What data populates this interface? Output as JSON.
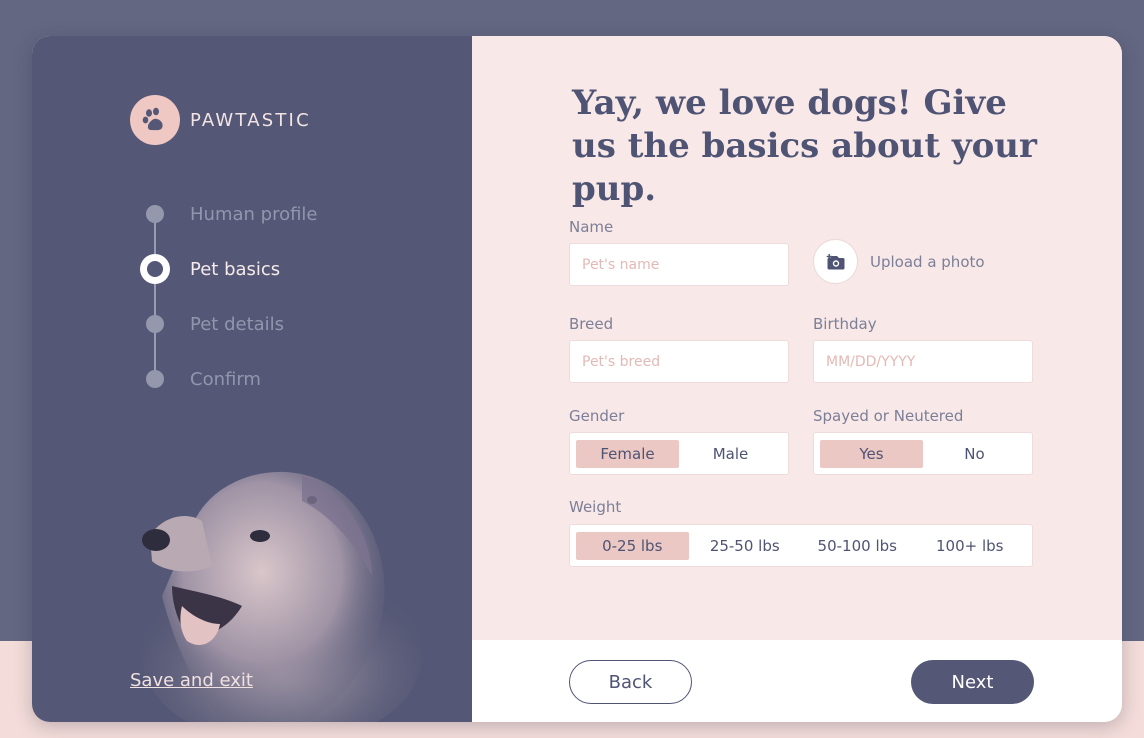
{
  "brand": {
    "name": "PAWTASTIC"
  },
  "steps": [
    {
      "label": "Human profile",
      "state": "done"
    },
    {
      "label": "Pet basics",
      "state": "active"
    },
    {
      "label": "Pet details",
      "state": "pending"
    },
    {
      "label": "Confirm",
      "state": "pending"
    }
  ],
  "save_exit": "Save and exit",
  "heading": "Yay, we love dogs! Give us the basics about your pup.",
  "form": {
    "name": {
      "label": "Name",
      "placeholder": "Pet's name",
      "value": ""
    },
    "upload": {
      "label": "Upload a photo",
      "icon": "camera-plus-icon"
    },
    "breed": {
      "label": "Breed",
      "placeholder": "Pet's breed",
      "value": ""
    },
    "birthday": {
      "label": "Birthday",
      "placeholder": "MM/DD/YYYY",
      "value": ""
    },
    "gender": {
      "label": "Gender",
      "options": [
        "Female",
        "Male"
      ],
      "selected": "Female"
    },
    "spayed": {
      "label": "Spayed or Neutered",
      "options": [
        "Yes",
        "No"
      ],
      "selected": "Yes"
    },
    "weight": {
      "label": "Weight",
      "options": [
        "0-25 lbs",
        "25-50 lbs",
        "50-100 lbs",
        "100+ lbs"
      ],
      "selected": "0-25 lbs"
    }
  },
  "buttons": {
    "back": "Back",
    "next": "Next"
  },
  "colors": {
    "background": "#636782",
    "panel": "#545775",
    "form_bg": "#f8e8e7",
    "accent_pink": "#ebc8c4",
    "text_dark": "#4f5374"
  }
}
